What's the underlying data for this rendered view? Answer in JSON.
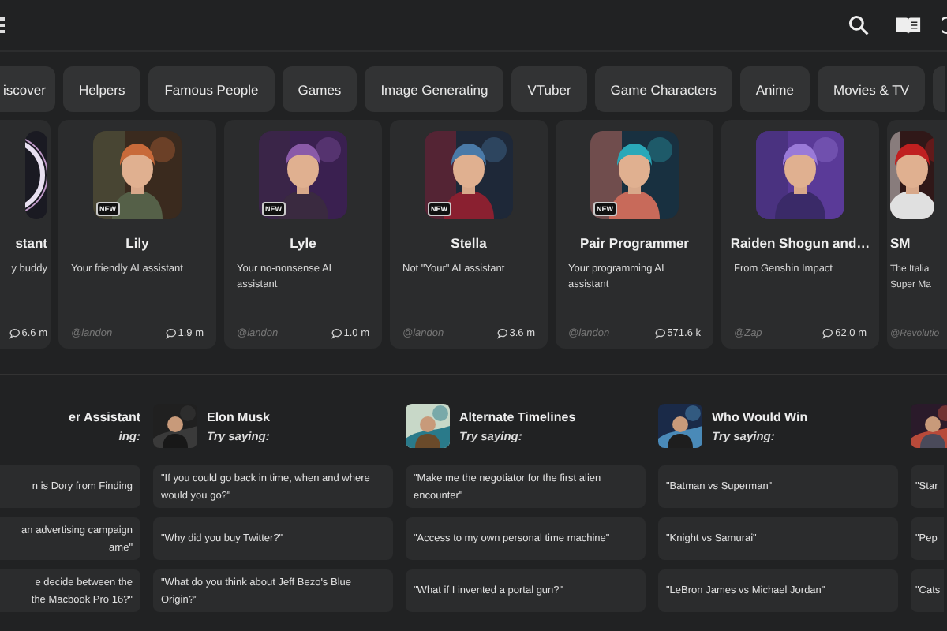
{
  "categories": [
    {
      "label": "iscover"
    },
    {
      "label": "Helpers"
    },
    {
      "label": "Famous People"
    },
    {
      "label": "Games"
    },
    {
      "label": "Image Generating"
    },
    {
      "label": "VTuber"
    },
    {
      "label": "Game Characters"
    },
    {
      "label": "Anime"
    },
    {
      "label": "Movies & TV"
    }
  ],
  "characters": [
    {
      "kind": "cut-left",
      "name": "stant",
      "description": "y buddy",
      "count": "6.6 m"
    },
    {
      "kind": "card",
      "name": "Lily",
      "description": "Your friendly AI assistant",
      "author": "@landon",
      "count": "1.9 m",
      "badge": "NEW"
    },
    {
      "kind": "card",
      "name": "Lyle",
      "description": "Your no-nonsense AI assistant",
      "author": "@landon",
      "count": "1.0 m",
      "badge": "NEW"
    },
    {
      "kind": "card",
      "name": "Stella",
      "description": "Not \"Your\" AI assistant",
      "author": "@landon",
      "count": "3.6 m",
      "badge": "NEW"
    },
    {
      "kind": "card",
      "name": "Pair Programmer",
      "description": "Your programming AI assistant",
      "author": "@landon",
      "count": "571.6 k",
      "badge": "NEW"
    },
    {
      "kind": "card",
      "name": "Raiden Shogun and…",
      "description": "From Genshin Impact",
      "author": "@Zap",
      "count": "62.0 m"
    },
    {
      "kind": "cut-right",
      "name": "SM",
      "description": "The Italia\nSuper Ma",
      "author": "@Revolutio"
    }
  ],
  "suggestions": [
    {
      "kind": "cut-left",
      "title": "er Assistant",
      "prompt_label": "ing:",
      "items": [
        "n is Dory from Finding\n ",
        "an advertising campaign\name\"",
        "e decide between the\nthe Macbook Pro 16?\""
      ]
    },
    {
      "kind": "column",
      "title": "Elon Musk",
      "prompt_label": "Try saying:",
      "items": [
        "\"If you could go back in time, when and where would you go?\"",
        "\"Why did you buy Twitter?\"",
        "\"What do you think about Jeff Bezo's Blue Origin?\""
      ]
    },
    {
      "kind": "column",
      "title": "Alternate Timelines",
      "prompt_label": "Try saying:",
      "items": [
        "\"Make me the negotiator for the first alien encounter\"",
        "\"Access to my own personal time machine\"",
        "\"What if I invented a portal gun?\""
      ]
    },
    {
      "kind": "column",
      "title": "Who Would Win",
      "prompt_label": "Try saying:",
      "items": [
        "\"Batman vs Superman\"",
        "\"Knight vs Samurai\"",
        "\"LeBron James vs Michael Jordan\""
      ]
    },
    {
      "kind": "cut-right",
      "items": [
        "\"Star",
        "\"Pep",
        "\"Cats"
      ]
    }
  ]
}
